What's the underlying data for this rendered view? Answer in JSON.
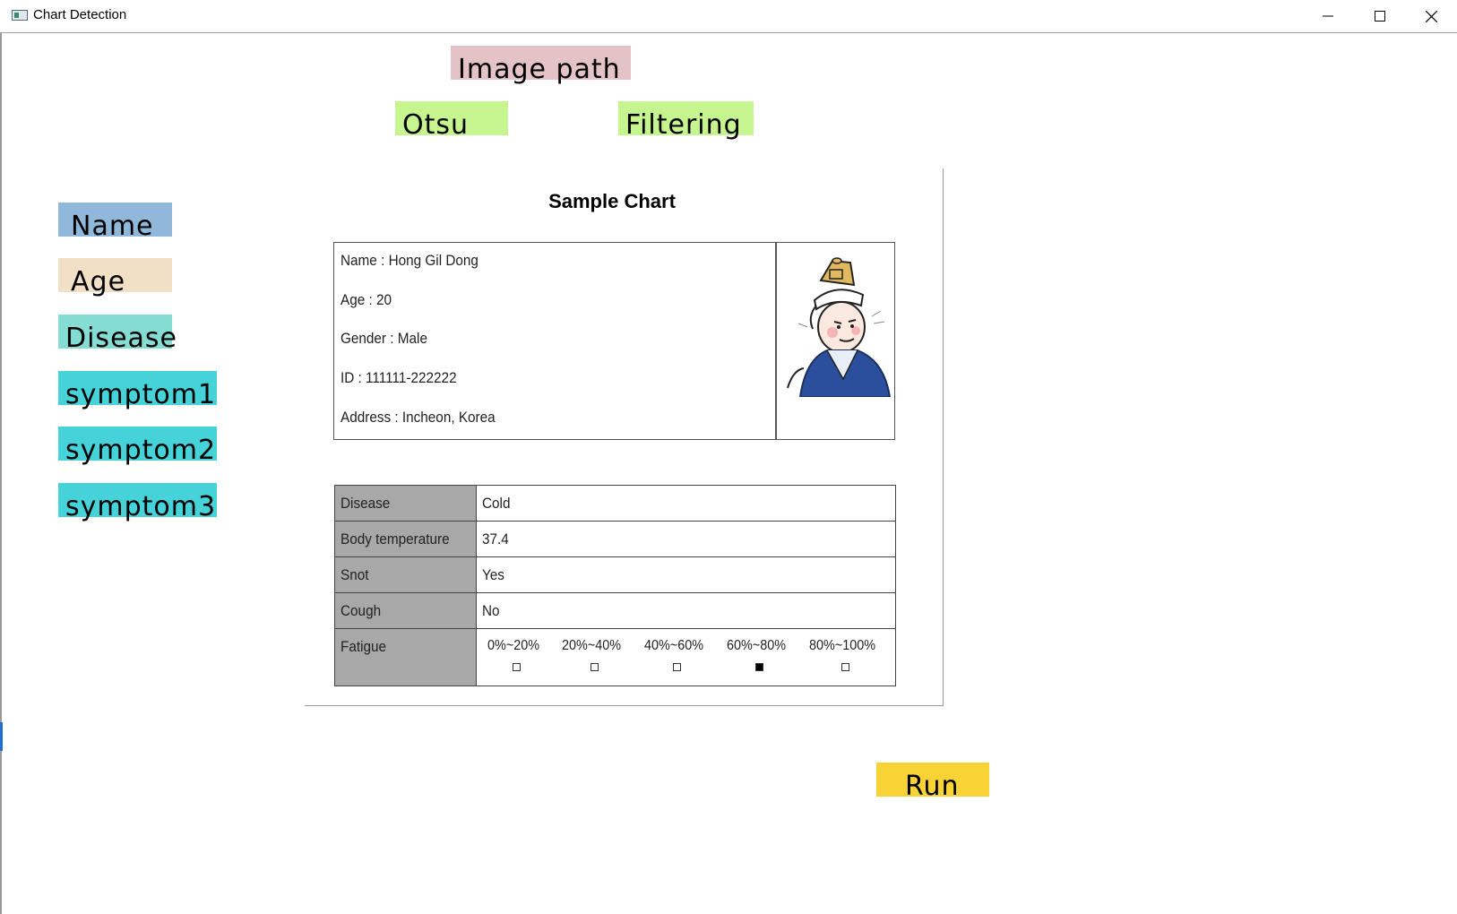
{
  "window": {
    "title": "Chart Detection"
  },
  "buttons": {
    "image_path": "Image path",
    "otsu": "Otsu",
    "filtering": "Filtering",
    "name": "Name",
    "age": "Age",
    "disease": "Disease",
    "symptom1": "symptom1",
    "symptom2": "symptom2",
    "symptom3": "symptom3",
    "run": "Run"
  },
  "colors": {
    "image_path": "#e4c3c6",
    "otsu_filtering": "#c6f48e",
    "name": "#8fb8db",
    "age": "#f2e0c6",
    "disease": "#84dcd2",
    "symptom": "#45d2d8",
    "run": "#f7d336"
  },
  "document": {
    "title": "Sample Chart",
    "info": [
      "Name : Hong Gil Dong",
      "Age : 20",
      "Gender : Male",
      "ID : 111111-222222",
      "Address : Incheon, Korea"
    ],
    "table": [
      {
        "key": "Disease",
        "value": "Cold"
      },
      {
        "key": "Body temperature",
        "value": "37.4"
      },
      {
        "key": "Snot",
        "value": "Yes"
      },
      {
        "key": "Cough",
        "value": "No"
      }
    ],
    "fatigue": {
      "key": "Fatigue",
      "options": [
        "0%~20%",
        "20%~40%",
        "40%~60%",
        "60%~80%",
        "80%~100%"
      ],
      "selected_index": 3
    }
  }
}
